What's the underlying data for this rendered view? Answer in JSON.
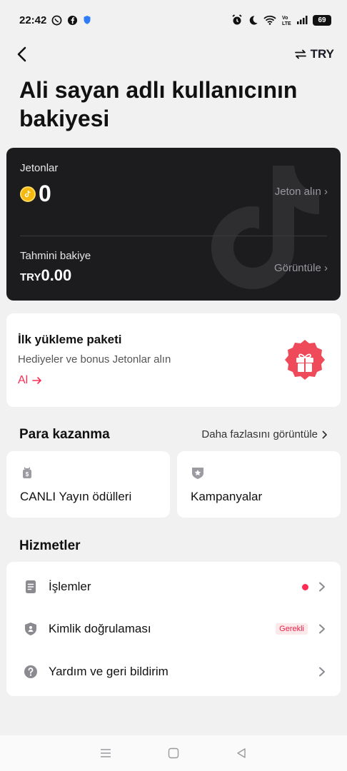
{
  "status_bar": {
    "time": "22:42",
    "battery": "69",
    "icons": [
      "whatsapp-icon",
      "facebook-icon",
      "shield-icon",
      "alarm-icon",
      "moon-icon",
      "wifi-icon",
      "volte-icon",
      "signal-icon",
      "battery-icon"
    ]
  },
  "topbar": {
    "currency": "TRY"
  },
  "page_title": "Ali sayan adlı kullanıcının bakiyesi",
  "balance_card": {
    "coins_label": "Jetonlar",
    "coins_value": "0",
    "get_coins_link": "Jeton alın ›",
    "estimated_label": "Tahmini bakiye",
    "estimated_currency": "TRY",
    "estimated_amount": "0.00",
    "view_link": "Görüntüle ›"
  },
  "first_package": {
    "title": "İlk yükleme paketi",
    "subtitle": "Hediyeler ve bonus Jetonlar alın",
    "cta": "Al"
  },
  "earn": {
    "title": "Para kazanma",
    "more": "Daha fazlasını görüntüle",
    "cards": [
      {
        "label": "CANLI Yayın ödülleri",
        "icon": "money-bag-icon"
      },
      {
        "label": "Kampanyalar",
        "icon": "star-badge-icon"
      }
    ]
  },
  "services": {
    "title": "Hizmetler",
    "items": [
      {
        "label": "İşlemler",
        "icon": "document-icon"
      },
      {
        "label": "Kimlik doğrulaması",
        "icon": "id-shield-icon",
        "badge": "Gerekli"
      },
      {
        "label": "Yardım ve geri bildirim",
        "icon": "help-icon"
      }
    ]
  },
  "colors": {
    "accent": "#fe2c55",
    "dark_card": "#1c1c1e",
    "coin": "#f5b80f",
    "background": "#f1f1f2"
  }
}
